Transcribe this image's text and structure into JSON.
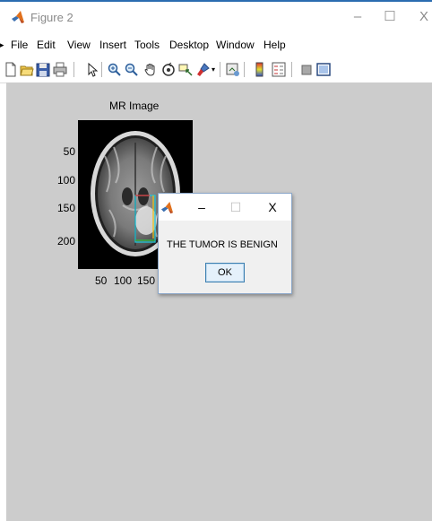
{
  "window": {
    "title": "Figure 2",
    "minimize_glyph": "–",
    "maximize_glyph": "☐",
    "close_glyph": "X"
  },
  "menu": {
    "arrow_glyph": "▸",
    "items": [
      "File",
      "Edit",
      "View",
      "Insert",
      "Tools",
      "Desktop",
      "Window",
      "Help"
    ]
  },
  "toolbar": {
    "icons": [
      "new-figure-icon",
      "open-file-icon",
      "save-icon",
      "print-icon",
      "edit-plot-arrow-icon",
      "zoom-in-icon",
      "zoom-out-icon",
      "pan-hand-icon",
      "rotate-3d-icon",
      "data-cursor-icon",
      "brush-icon",
      "link-plot-icon",
      "insert-colorbar-icon",
      "insert-legend-icon",
      "hide-plot-tools-icon",
      "show-plot-tools-icon"
    ]
  },
  "axes": {
    "title": "MR Image",
    "yticks": [
      "50",
      "100",
      "150",
      "200"
    ],
    "xticks": [
      "50",
      "100",
      "150"
    ]
  },
  "dialog": {
    "minimize_glyph": "–",
    "maximize_glyph": "☐",
    "close_glyph": "X",
    "message": "THE TUMOR IS BENIGN",
    "ok_label": "OK"
  },
  "colors": {
    "figure_background": "#cccccc",
    "title_text": "#8a8a8a",
    "dialog_background": "#f0f0f0",
    "ok_button_border": "#3c7fb1",
    "matlab_logo_orange": "#e0701c",
    "bbox_cyan": "#22c4d8",
    "bbox_red": "#e03030",
    "bbox_yellow": "#e8c020",
    "bbox_green": "#30c040"
  }
}
